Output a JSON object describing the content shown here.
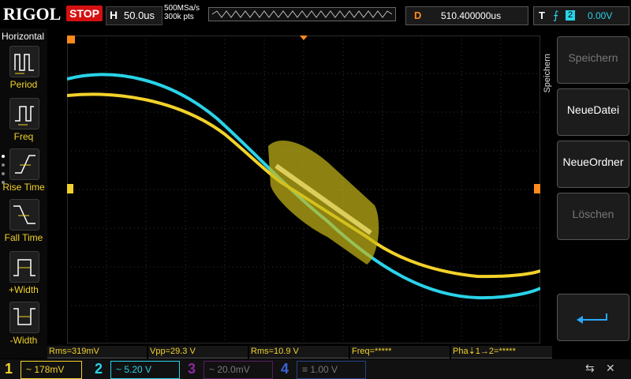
{
  "brand": "RIGOL",
  "run_state": "STOP",
  "horizontal": {
    "letter": "H",
    "timebase": "50.0us",
    "sample_rate": "500MSa/s",
    "memory": "300k pts"
  },
  "delay": {
    "letter": "D",
    "value": "510.400000us"
  },
  "trigger": {
    "letter": "T",
    "edge": "rising",
    "source": "2",
    "level": "0.00V"
  },
  "left_menu": {
    "title": "Horizontal",
    "items": [
      {
        "label": "Period",
        "icon": "period-icon"
      },
      {
        "label": "Freq",
        "icon": "frequency-icon"
      },
      {
        "label": "Rise Time",
        "icon": "rise-time-icon"
      },
      {
        "label": "Fall Time",
        "icon": "fall-time-icon"
      },
      {
        "label": "+Width",
        "icon": "positive-width-icon"
      },
      {
        "label": "-Width",
        "icon": "negative-width-icon"
      }
    ]
  },
  "right_menu": {
    "title": "Speichern",
    "buttons": [
      {
        "label": "Speichern",
        "enabled": false
      },
      {
        "label": "NeueDatei",
        "enabled": true
      },
      {
        "label": "NeueOrdner",
        "enabled": true
      },
      {
        "label": "Löschen",
        "enabled": false
      }
    ],
    "back_icon": "return-arrow-icon"
  },
  "measurements": [
    {
      "text": "Rms=319mV"
    },
    {
      "text": "Vpp=29.3 V"
    },
    {
      "text": "Rms=10.9 V"
    },
    {
      "text": "Freq=*****"
    },
    {
      "text": "Pha⇣1→2=*****"
    }
  ],
  "channels": [
    {
      "num": "1",
      "coupling": "~",
      "scale": "178mV",
      "color": "#f2d22a",
      "active": true
    },
    {
      "num": "2",
      "coupling": "~",
      "scale": "5.20 V",
      "color": "#29d3e8",
      "active": true
    },
    {
      "num": "3",
      "coupling": "~",
      "scale": "20.0mV",
      "color": "#8a2aa0",
      "active": false
    },
    {
      "num": "4",
      "coupling": "≡",
      "scale": "1.00 V",
      "color": "#3b63d8",
      "active": false
    }
  ],
  "colors": {
    "ch1": "#f2d22a",
    "ch2": "#29d3e8",
    "accent": "#ff8a1d",
    "stop": "#d41010"
  }
}
